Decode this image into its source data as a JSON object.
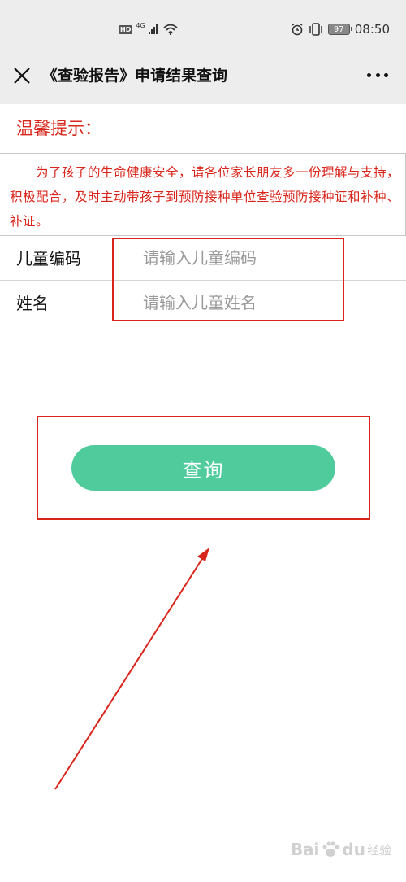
{
  "status_bar": {
    "hd_badge": "HD",
    "network": "4G",
    "battery": "97",
    "time": "08:50"
  },
  "nav": {
    "title": "《查验报告》申请结果查询"
  },
  "tip": {
    "title": "温馨提示：",
    "text": "为了孩子的生命健康安全，请各位家长朋友多一份理解与支持，积极配合，及时主动带孩子到预防接种单位查验预防接种证和补种、补证。"
  },
  "form": {
    "child_code": {
      "label": "儿童编码",
      "placeholder": "请输入儿童编码",
      "value": ""
    },
    "name": {
      "label": "姓名",
      "placeholder": "请输入儿童姓名",
      "value": ""
    }
  },
  "query_button_label": "查询",
  "watermark": {
    "brand": "Bai",
    "brand2": "du",
    "sub": "经验"
  },
  "colors": {
    "accent_red": "#d9261c",
    "button_green": "#4fcb9c",
    "bar_bg": "#ededed"
  }
}
